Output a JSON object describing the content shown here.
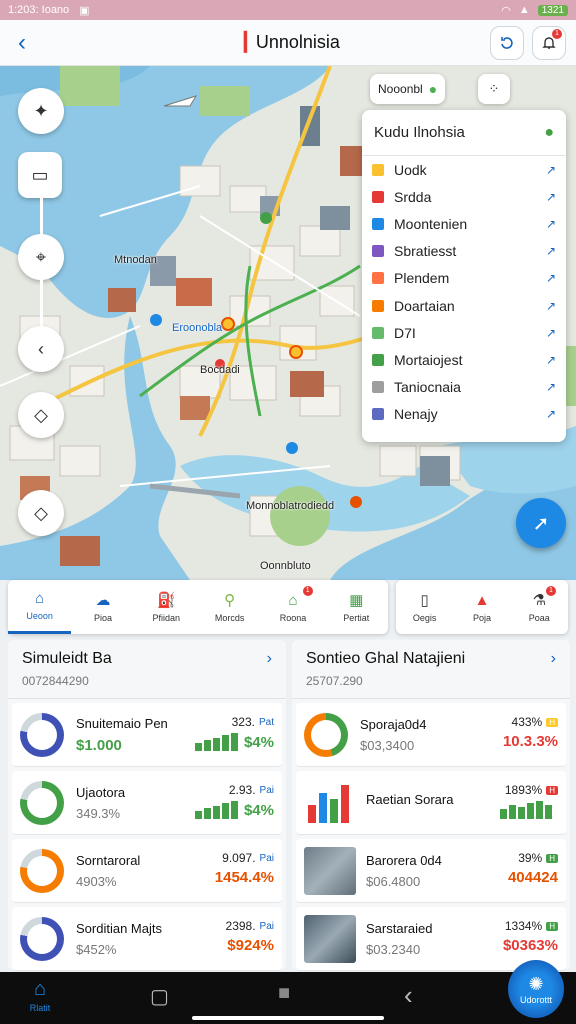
{
  "status": {
    "time": "1:203: Ioano",
    "battery": "1321"
  },
  "header": {
    "title": "Unnolnisia"
  },
  "map": {
    "search_text": "Nooonbl",
    "labels": [
      "Mtnodan",
      "Eroonobla",
      "Bocdadi",
      "Monnoblatrodiedd",
      "Oonnbluto"
    ]
  },
  "category_panel": {
    "title": "Kudu Ilnohsia",
    "items": [
      {
        "label": "Uodk",
        "color": "#fbc02d"
      },
      {
        "label": "Srdda",
        "color": "#e53935"
      },
      {
        "label": "Moontenien",
        "color": "#1e88e5"
      },
      {
        "label": "Sbratiesst",
        "color": "#7e57c2"
      },
      {
        "label": "Plendem",
        "color": "#ff7043"
      },
      {
        "label": "Doartaian",
        "color": "#f57c00"
      },
      {
        "label": "D7I",
        "color": "#66bb6a"
      },
      {
        "label": "Mortaiojest",
        "color": "#43a047"
      },
      {
        "label": "Taniocnaia",
        "color": "#9e9e9e"
      },
      {
        "label": "Nenajy",
        "color": "#5c6bc0"
      }
    ]
  },
  "tabs_left": [
    {
      "label": "Ueoon",
      "icon": "home-icon",
      "active": true
    },
    {
      "label": "Pioa",
      "icon": "cloud-icon"
    },
    {
      "label": "Pfiidan",
      "icon": "fuel-icon"
    },
    {
      "label": "Morcds",
      "icon": "location-icon"
    },
    {
      "label": "Roona",
      "icon": "building-icon",
      "badge": "1"
    },
    {
      "label": "Pertiat",
      "icon": "grid-icon"
    }
  ],
  "tabs_right": [
    {
      "label": "Oegis",
      "icon": "document-icon"
    },
    {
      "label": "Poja",
      "icon": "car-icon"
    },
    {
      "label": "Poaa",
      "icon": "flask-icon",
      "badge": "1"
    }
  ],
  "stats_left": {
    "title": "Simuleidt Ba",
    "subtitle": "0072844290",
    "cards": [
      {
        "name": "Snuitemaio Pen",
        "sub": "$1.000",
        "value": "323.",
        "unit": "Pat",
        "pct": "$4%",
        "donut_color": "#3f51b5"
      },
      {
        "name": "Ujaotora",
        "sub": "349.3%",
        "value": "2.93.",
        "unit": "Pai",
        "pct": "$4%",
        "donut_color": "#43a047"
      },
      {
        "name": "Sorntaroral",
        "sub": "4903%",
        "value": "9.097.",
        "unit": "Pai",
        "pct": "1454.4%",
        "donut_color": "#f57c00"
      },
      {
        "name": "Sorditian Majts",
        "sub": "$452%",
        "value": "2398.",
        "unit": "Pai",
        "pct": "$924%",
        "donut_color": "#3f51b5"
      }
    ]
  },
  "stats_right": {
    "title": "Sontieo Ghal Natajieni",
    "subtitle": "25707.290",
    "cards": [
      {
        "name": "Sporaja0d4",
        "sub": "$03,3400",
        "value": "433%",
        "tag": "H",
        "pct": "10.3.3%",
        "thumb": "mosque"
      },
      {
        "name": "Raetian Sorara",
        "sub": "",
        "value": "1893%",
        "tag": "H",
        "pct": "",
        "thumb": "barchart"
      },
      {
        "name": "Barorera 0d4",
        "sub": "$06.4800",
        "value": "39%",
        "tag": "H",
        "pct": "404424",
        "thumb": "aerial"
      },
      {
        "name": "Sarstaraied",
        "sub": "$03.2340",
        "value": "1334%",
        "tag": "H",
        "pct": "$0363%",
        "thumb": "city"
      }
    ]
  },
  "navbar": {
    "home": "Rlatit",
    "right": "Udorottt"
  }
}
